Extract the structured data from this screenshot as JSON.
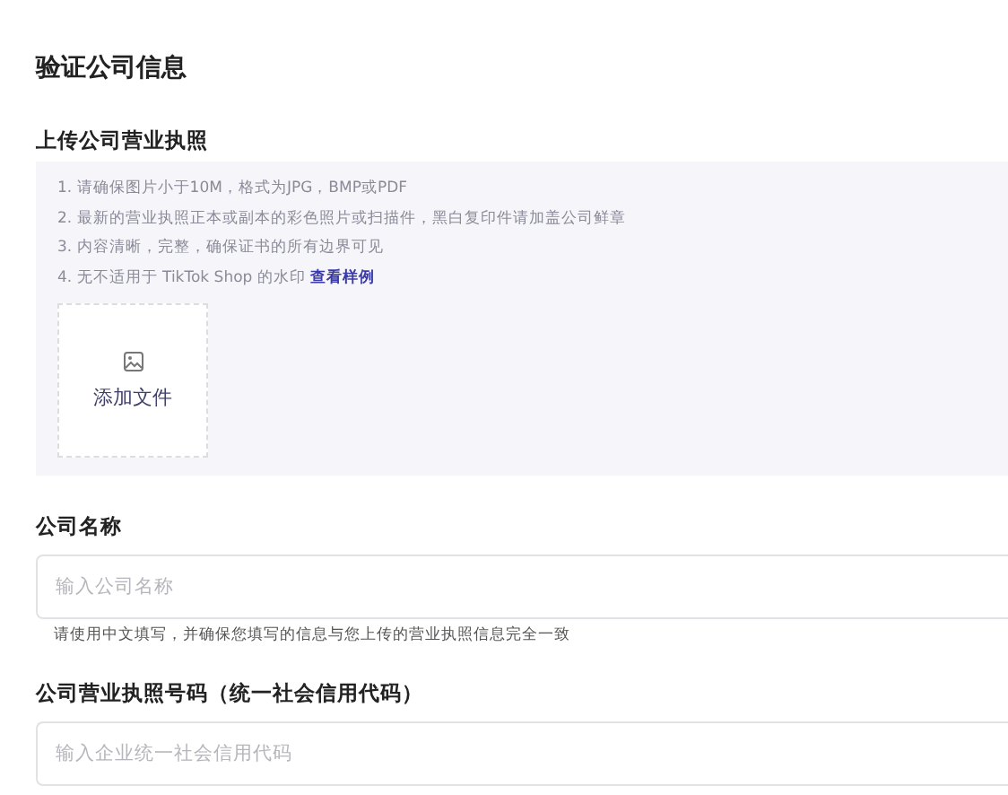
{
  "title": "验证公司信息",
  "upload": {
    "label": "上传公司营业执照",
    "notes": [
      {
        "text": "1. 请确保图片小于10M，格式为JPG，BMP或PDF"
      },
      {
        "text": "2. 最新的营业执照正本或副本的彩色照片或扫描件，黑白复印件请加盖公司鲜章"
      },
      {
        "text": "3. 内容清晰，完整，确保证书的所有边界可见"
      },
      {
        "text": "4. 无不适用于 TikTok Shop 的水印",
        "link": "查看样例"
      }
    ],
    "button": "添加文件"
  },
  "fields": [
    {
      "label": "公司名称",
      "placeholder": "输入公司名称",
      "hint": "请使用中文填写，并确保您填写的信息与您上传的营业执照信息完全一致"
    },
    {
      "label": "公司营业执照号码（统一社会信用代码）",
      "placeholder": "输入企业统一社会信用代码"
    }
  ]
}
